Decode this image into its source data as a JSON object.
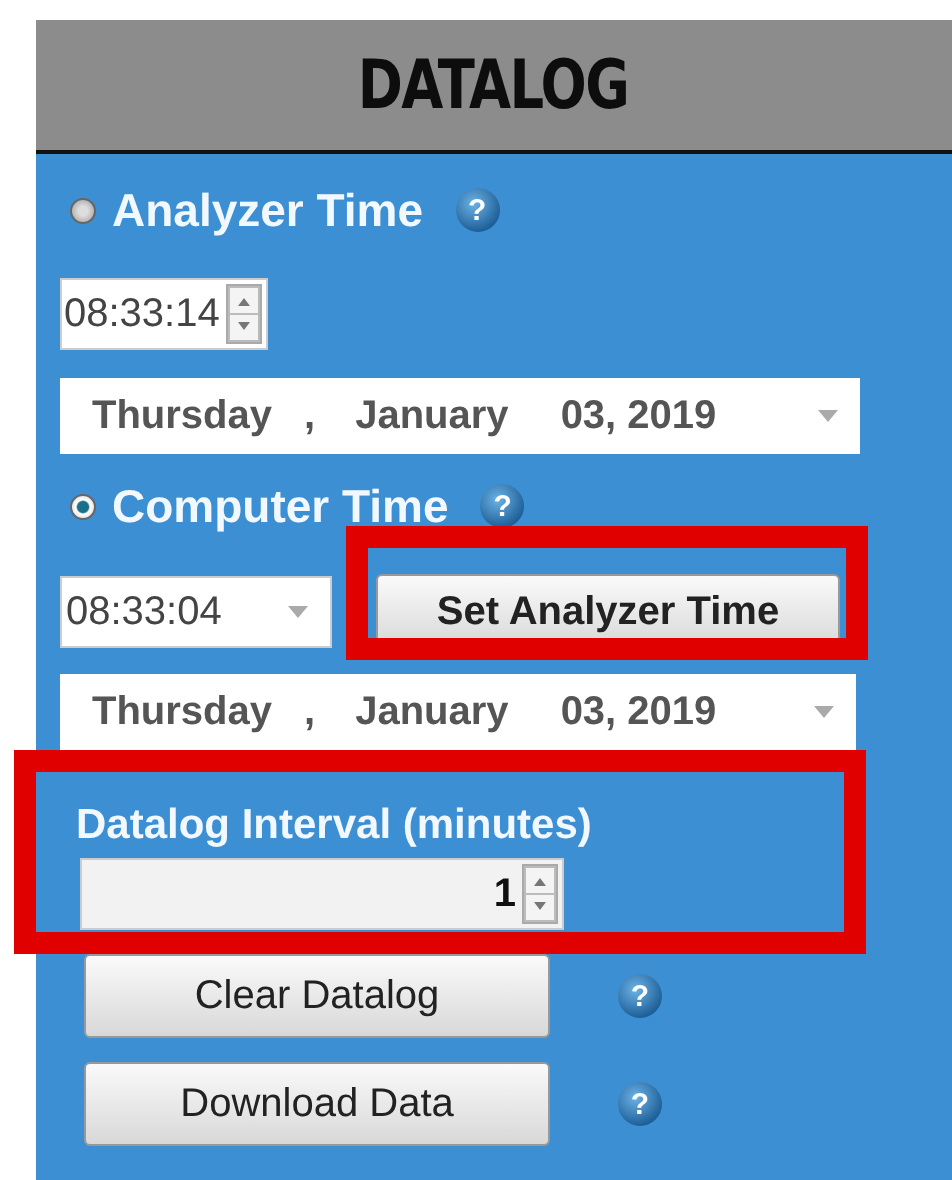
{
  "header": {
    "title": "DATALOG"
  },
  "analyzer": {
    "label": "Analyzer Time",
    "selected": false,
    "help": "?",
    "time": "08:33:14",
    "date": [
      "Thursday",
      ",",
      "January",
      "03, 2019"
    ]
  },
  "computer": {
    "label": "Computer Time",
    "selected": true,
    "help": "?",
    "time": "08:33:04",
    "date": [
      "Thursday",
      ",",
      "January",
      "03, 2019"
    ]
  },
  "set_button": {
    "label": "Set Analyzer Time"
  },
  "interval": {
    "label": "Datalog Interval (minutes)",
    "value": "1"
  },
  "actions": [
    {
      "label": "Clear Datalog",
      "help": "?"
    },
    {
      "label": "Download Data",
      "help": "?"
    }
  ]
}
